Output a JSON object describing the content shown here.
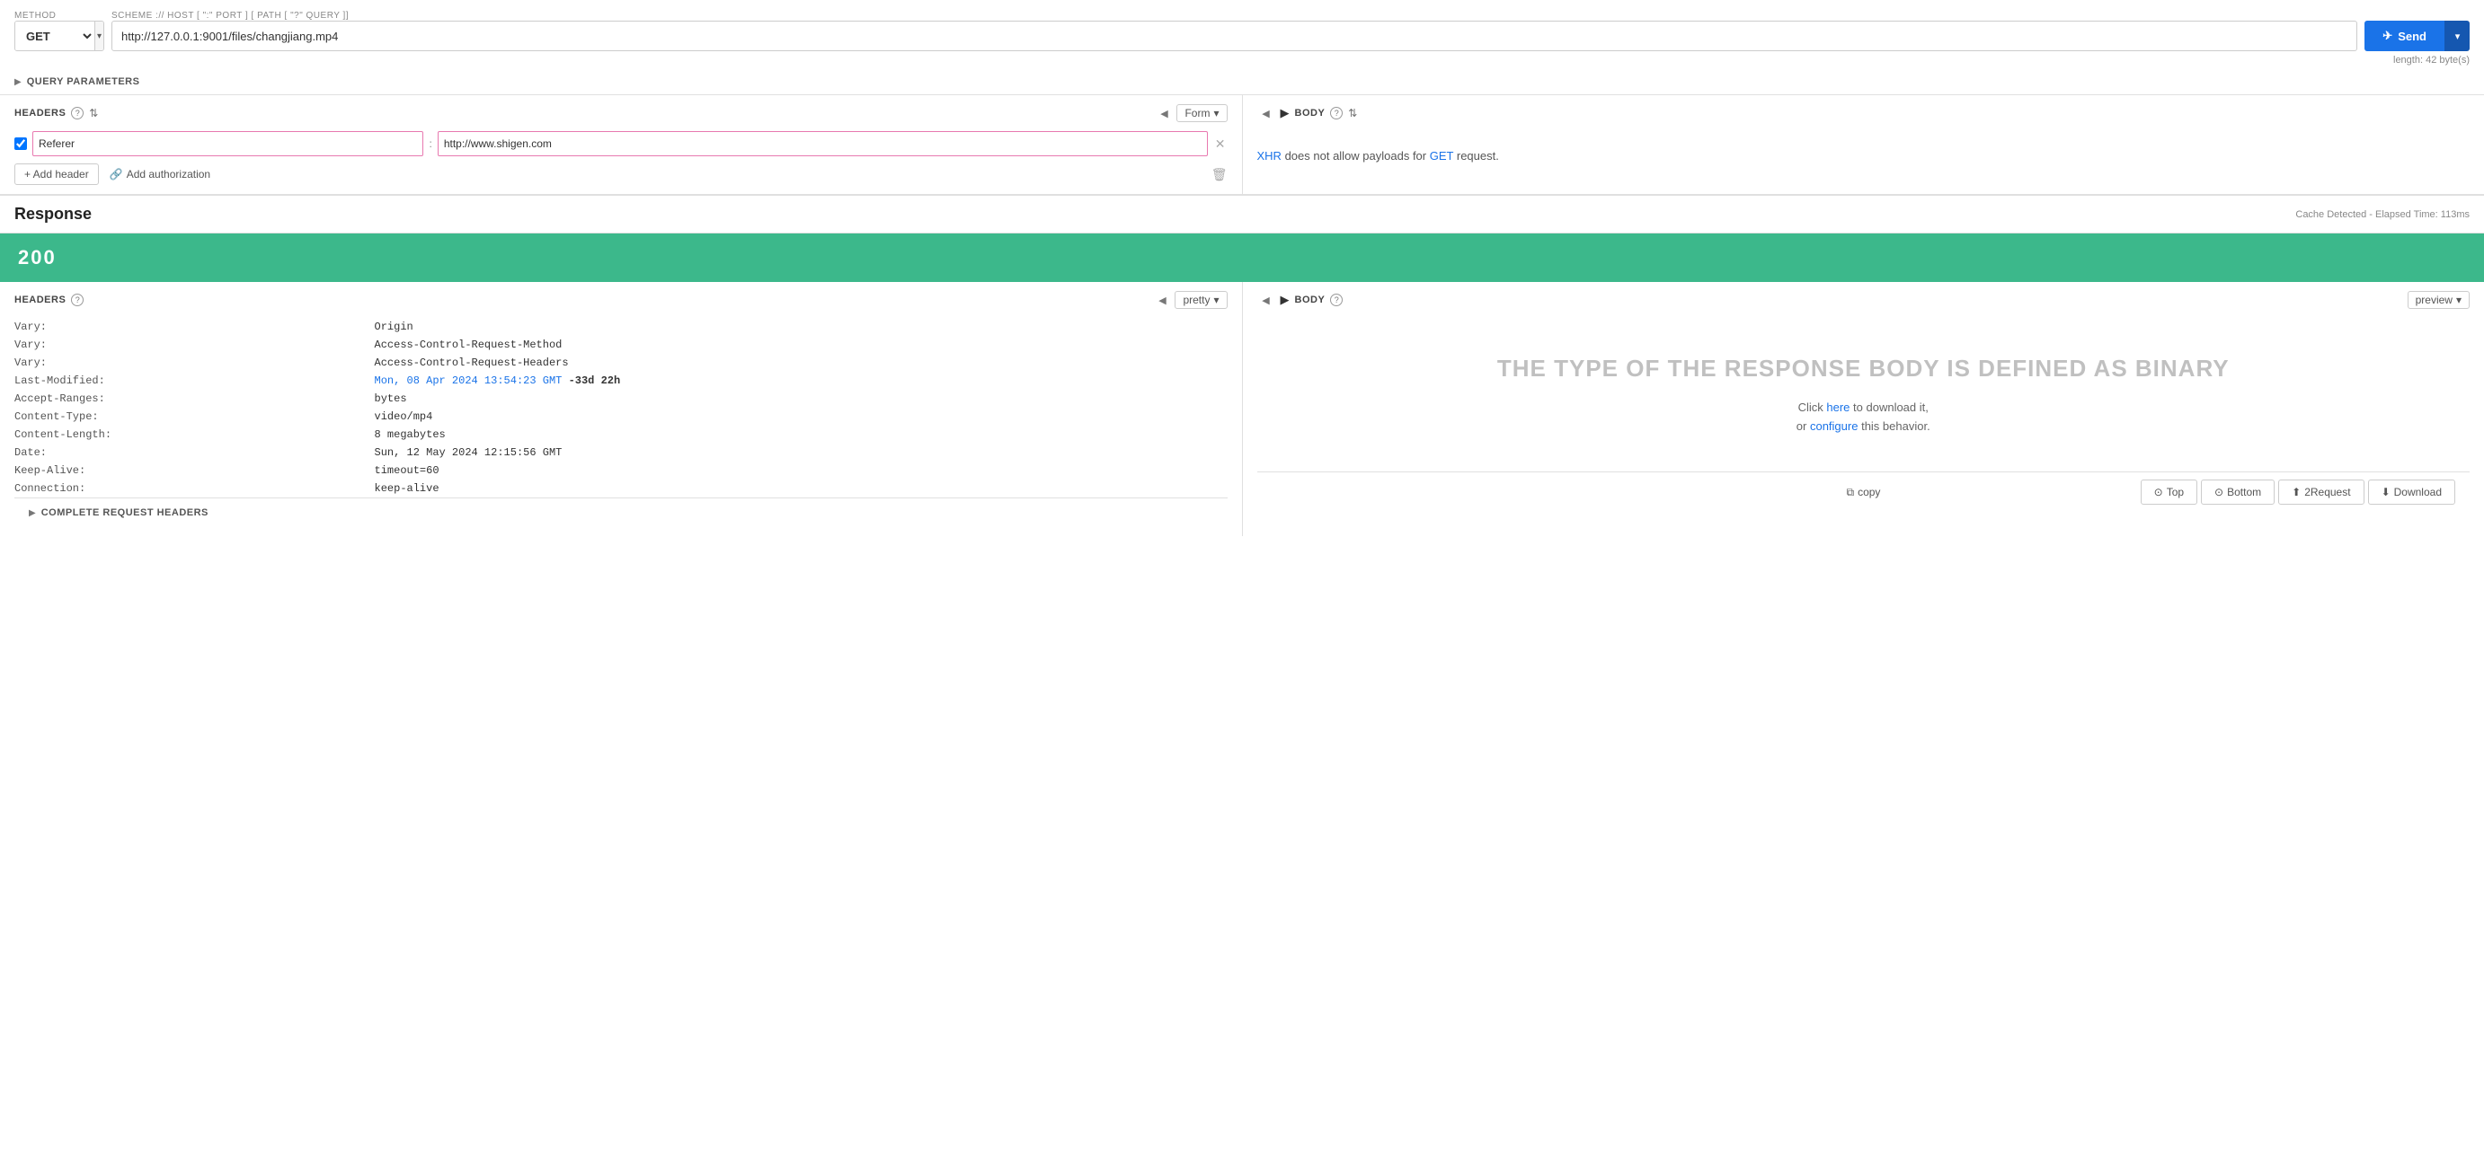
{
  "method": {
    "label": "METHOD",
    "value": "GET",
    "dropdown_arrow": "▾"
  },
  "url": {
    "label": "SCHEME :// HOST [ \":\" PORT ] [ PATH [ \"?\" QUERY ]]",
    "value": "http://127.0.0.1:9001/files/changjiang.mp4",
    "length_info": "length: 42 byte(s)"
  },
  "send_button": {
    "label": "Send",
    "arrow": "▾",
    "icon": "✈"
  },
  "query_params": {
    "label": "QUERY PARAMETERS",
    "chevron": "▶"
  },
  "request_headers": {
    "section_title": "HEADERS",
    "form_label": "Form",
    "form_arrow": "▾",
    "nav_left": "◀",
    "nav_right": "▶",
    "rows": [
      {
        "checked": true,
        "key": "Referer",
        "value": "http://www.shigen.com"
      }
    ],
    "add_header_label": "+ Add header",
    "add_auth_label": "Add authorization",
    "add_auth_icon": "🔗"
  },
  "request_body": {
    "section_title": "BODY",
    "nav_left": "◀",
    "nav_right": "▶",
    "xhr_message": "XHR does not allow payloads for",
    "xhr_link": "XHR",
    "get_link": "GET",
    "xhr_suffix": "request."
  },
  "response": {
    "title": "Response",
    "elapsed_info": "Cache Detected - Elapsed Time: 113ms",
    "status_code": "200",
    "status_bg": "#3cb88b",
    "headers_section": {
      "section_title": "HEADERS",
      "pretty_label": "pretty",
      "pretty_arrow": "▾",
      "nav_left": "◀",
      "nav_right": "▶",
      "rows": [
        {
          "key": "Vary:",
          "value": "Origin"
        },
        {
          "key": "Vary:",
          "value": "Access-Control-Request-Method"
        },
        {
          "key": "Vary:",
          "value": "Access-Control-Request-Headers"
        },
        {
          "key": "Last-Modified:",
          "value": "Mon, 08 Apr 2024 13:54:23 GMT -33d 22h",
          "has_link": true,
          "link_part": "Mon, 08 Apr 2024 13:54:23 GMT"
        },
        {
          "key": "Accept-Ranges:",
          "value": "bytes"
        },
        {
          "key": "Content-Type:",
          "value": "video/mp4"
        },
        {
          "key": "Content-Length:",
          "value": "8 megabytes"
        },
        {
          "key": "Date:",
          "value": "Sun, 12 May 2024 12:15:56 GMT"
        },
        {
          "key": "Keep-Alive:",
          "value": "timeout=60"
        },
        {
          "key": "Connection:",
          "value": "keep-alive"
        }
      ]
    },
    "body_section": {
      "section_title": "BODY",
      "preview_label": "preview",
      "preview_arrow": "▾",
      "binary_title": "THE TYPE OF THE RESPONSE BODY IS DEFINED AS BINARY",
      "binary_desc_prefix": "Click",
      "binary_here_link": "here",
      "binary_desc_middle": "to download it,",
      "binary_desc_or": "or",
      "binary_configure_link": "configure",
      "binary_desc_suffix": "this behavior."
    },
    "copy_btn": "copy",
    "bottom_buttons": [
      {
        "id": "top",
        "icon": "⊙",
        "label": "Top"
      },
      {
        "id": "bottom",
        "icon": "⊙",
        "label": "Bottom"
      },
      {
        "id": "to-request",
        "icon": "⬆",
        "label": "2Request"
      },
      {
        "id": "download",
        "icon": "⬇",
        "label": "Download"
      }
    ]
  },
  "complete_request": {
    "label": "COMPLETE REQUEST HEADERS",
    "chevron": "▶"
  }
}
